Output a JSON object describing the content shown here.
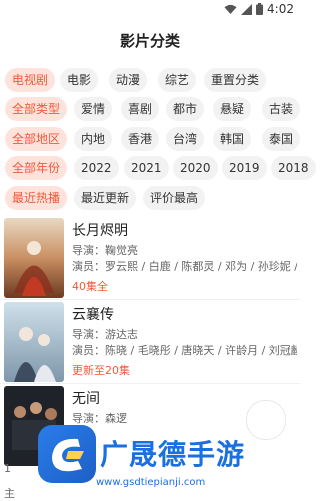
{
  "status_bar": {
    "time": "4:02"
  },
  "page": {
    "title": "影片分类"
  },
  "filters": {
    "type": [
      "电视剧",
      "电影",
      "动漫",
      "综艺",
      "重置分类"
    ],
    "genre": [
      "全部类型",
      "爱情",
      "喜剧",
      "都市",
      "悬疑",
      "古装"
    ],
    "region": [
      "全部地区",
      "内地",
      "香港",
      "台湾",
      "韩国",
      "泰国"
    ],
    "year": [
      "全部年份",
      "2022",
      "2021",
      "2020",
      "2019",
      "2018"
    ],
    "sort": [
      "最近热播",
      "最近更新",
      "评价最高"
    ]
  },
  "shows": [
    {
      "title": "长月烬明",
      "director": "导演：鞠觉亮",
      "cast": "演员：罗云熙 / 白鹿 / 陈都灵 / 邓为 / 孙珍妮 /",
      "status": "40集全"
    },
    {
      "title": "云襄传",
      "director": "导演：游达志",
      "cast": "演员：陈晓 / 毛晓彤 / 唐晓天 / 许龄月 / 刘冠麟",
      "status": "更新至20集"
    },
    {
      "title": "无间",
      "director": "导演：森逻",
      "cast": "",
      "status": ""
    }
  ],
  "colors": {
    "accent": "#f05a3a",
    "accent_bg": "#fde3db",
    "chip_bg": "#f2f2f2"
  },
  "watermark": {
    "text": "广晟德手游",
    "url": "www.gsdtiepianji.com"
  },
  "bottom_fragments": [
    "1",
    "主"
  ]
}
